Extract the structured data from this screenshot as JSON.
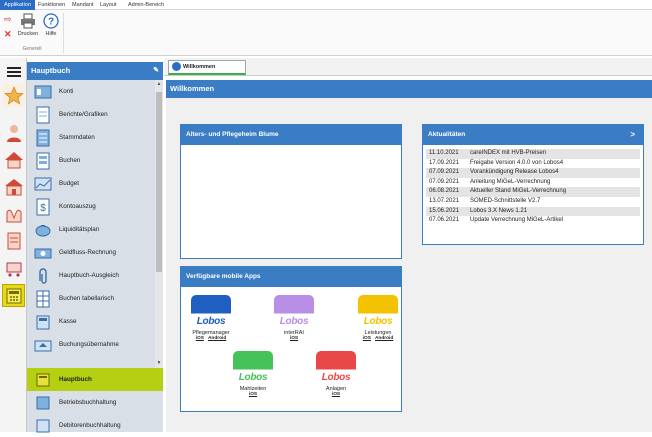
{
  "menubar": {
    "tabs": [
      {
        "label": "Applikation",
        "active": true
      },
      {
        "label": "Funktionen",
        "active": false
      },
      {
        "label": "Mandant",
        "active": false
      },
      {
        "label": "Layout",
        "active": false
      },
      {
        "label": "Admin-Bereich",
        "active": false
      }
    ]
  },
  "ribbon": {
    "print_label": "Drucken",
    "help_label": "Hilfe",
    "group_label": "Generell"
  },
  "nav": {
    "title": "Hauptbuch",
    "items": [
      {
        "label": "Konti",
        "icon": "accounts-icon"
      },
      {
        "label": "Berichte/Grafiken",
        "icon": "report-icon"
      },
      {
        "label": "Stammdaten",
        "icon": "masterdata-icon"
      },
      {
        "label": "Buchen",
        "icon": "booking-icon"
      },
      {
        "label": "Budget",
        "icon": "budget-chart-icon"
      },
      {
        "label": "Kontoauszug",
        "icon": "statement-icon"
      },
      {
        "label": "Liquiditätsplan",
        "icon": "piggybank-icon"
      },
      {
        "label": "Geldfluss-Rechnung",
        "icon": "cashflow-icon"
      },
      {
        "label": "Hauptbuch-Ausgleich",
        "icon": "paperclip-icon"
      },
      {
        "label": "Buchen tabellarisch",
        "icon": "table-icon"
      },
      {
        "label": "Kasse",
        "icon": "cashbox-icon"
      },
      {
        "label": "Buchungsübernahme",
        "icon": "import-icon"
      }
    ],
    "sections": [
      {
        "label": "Hauptbuch",
        "selected": true
      },
      {
        "label": "Betriebsbuchhaltung",
        "selected": false
      },
      {
        "label": "Debitorenbuchhaltung",
        "selected": false
      }
    ]
  },
  "tab": {
    "label": "Willkommen"
  },
  "welcome": {
    "title": "Willkommen"
  },
  "home_card": {
    "title": "Alters- und Pflegeheim Blume"
  },
  "news": {
    "title": "Aktualitäten",
    "more": ">",
    "items": [
      {
        "date": "11.10.2021",
        "text": "careINDEX mit HVB-Preisen"
      },
      {
        "date": "17.09.2021",
        "text": "Freigabe Version 4.0.0 von Lobos4"
      },
      {
        "date": "07.09.2021",
        "text": "Vorankündigung Release Lobos4"
      },
      {
        "date": "07.09.2021",
        "text": "Anleitung MiGeL-Verrechnung"
      },
      {
        "date": "06.08.2021",
        "text": "Aktueller Stand MiGeL-Verrechnung"
      },
      {
        "date": "13.07.2021",
        "text": "SOMED-Schnittstelle V2.7"
      },
      {
        "date": "15.06.2021",
        "text": "Lobos 3.X News 1.21"
      },
      {
        "date": "07.06.2021",
        "text": "Update Verrechnung MiGeL-Artikel"
      }
    ]
  },
  "apps": {
    "title": "Verfügbare mobile Apps",
    "items": [
      {
        "name": "Pflegemanager",
        "ios": "iOS",
        "android": "Android",
        "color": "#1f5fbf",
        "logo": "Lobos"
      },
      {
        "name": "interRAI",
        "ios": "iOS",
        "android": "",
        "color": "#b98ee6",
        "logo": "Lobos"
      },
      {
        "name": "Leistungen",
        "ios": "iOS",
        "android": "Android",
        "color": "#f2c200",
        "logo": "Lobos"
      },
      {
        "name": "Mahlzeiten",
        "ios": "iOS",
        "android": "",
        "color": "#46c25a",
        "logo": "Lobos"
      },
      {
        "name": "Anlagen",
        "ios": "iOS",
        "android": "",
        "color": "#e84848",
        "logo": "Lobos"
      }
    ]
  },
  "colors": {
    "accent": "#3b7dc4",
    "selected": "#b5cf12"
  }
}
